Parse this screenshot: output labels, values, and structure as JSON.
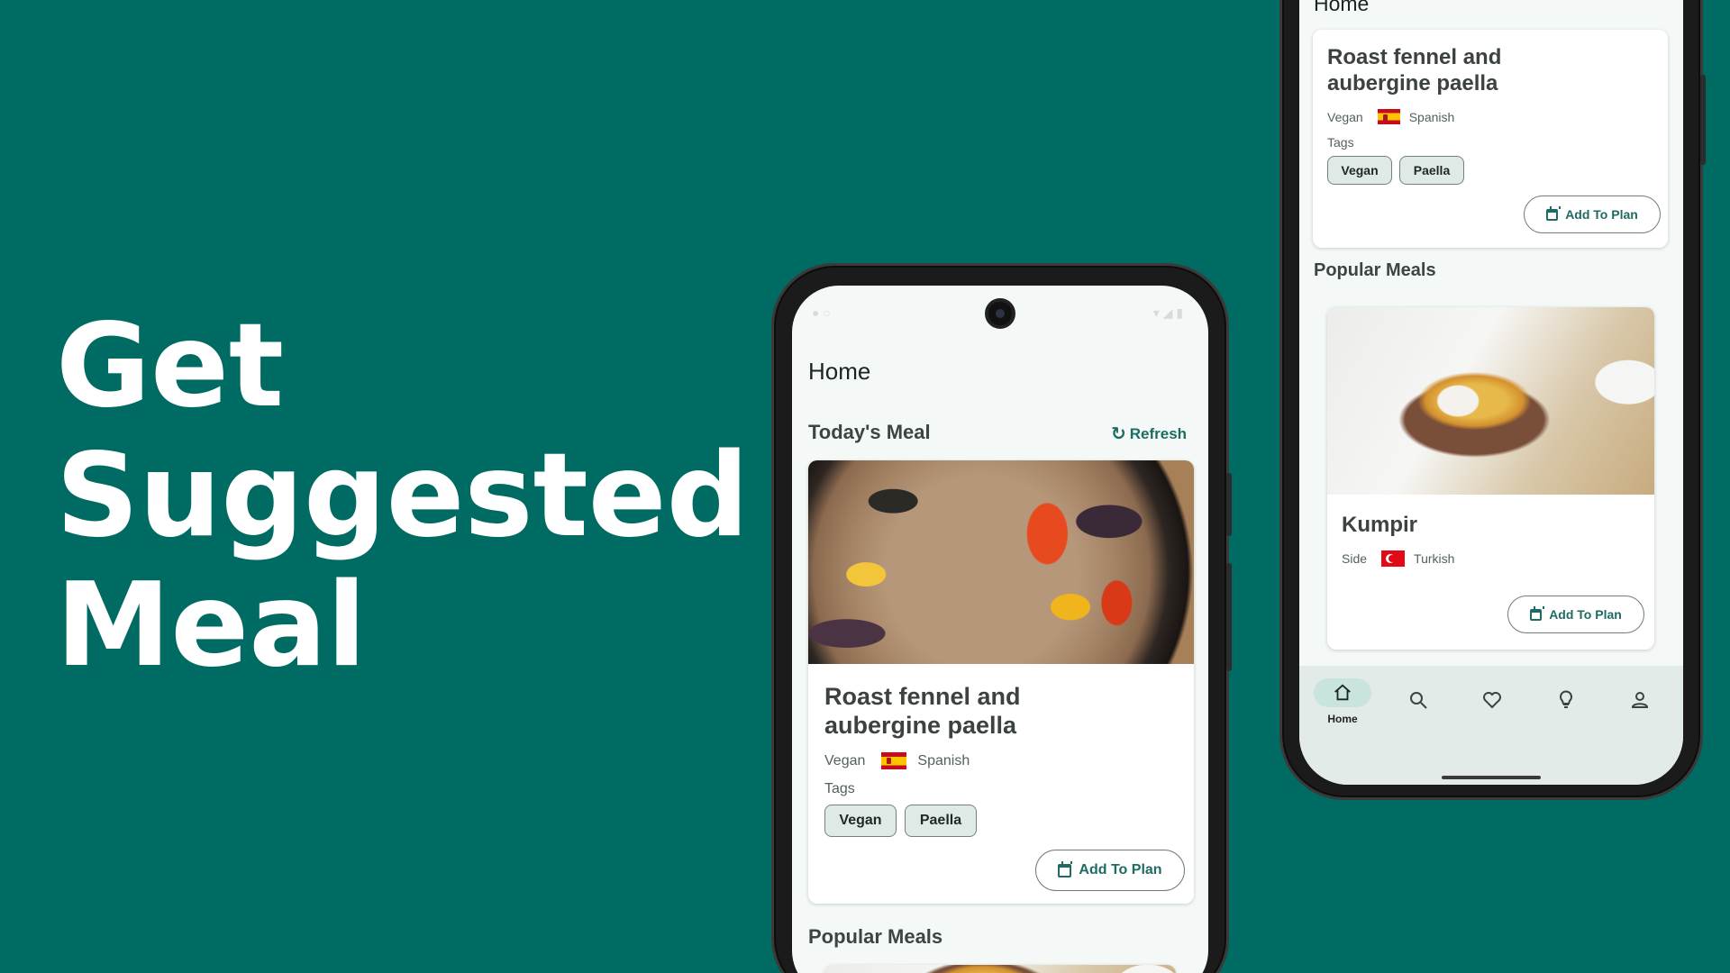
{
  "headline": {
    "line1": "Get",
    "line2": "Suggested",
    "line3": "Meal"
  },
  "colors": {
    "background": "#006b62",
    "accent": "#1e6b63",
    "chip_bg": "#dfe9e6",
    "screen_bg": "#f4f9f7"
  },
  "phone_main": {
    "app_bar_title": "Home",
    "todays_meal_title": "Today's Meal",
    "refresh_label": "Refresh",
    "meal": {
      "name_line1": "Roast fennel and",
      "name_line2": "aubergine paella",
      "category": "Vegan",
      "area": "Spanish",
      "tags_label": "Tags",
      "tags": [
        "Vegan",
        "Paella"
      ],
      "add_to_plan_label": "Add To Plan"
    },
    "popular_title": "Popular Meals"
  },
  "phone_secondary": {
    "app_bar_title": "Home",
    "meal": {
      "name_line1": "Roast fennel and",
      "name_line2": "aubergine paella",
      "category": "Vegan",
      "area": "Spanish",
      "tags_label": "Tags",
      "tags": [
        "Vegan",
        "Paella"
      ],
      "add_to_plan_label": "Add To Plan"
    },
    "popular_title": "Popular Meals",
    "popular_meal": {
      "name": "Kumpir",
      "category": "Side",
      "area": "Turkish",
      "add_to_plan_label": "Add To Plan"
    },
    "bottom_nav": {
      "home_label": "Home",
      "icons": [
        "home-icon",
        "search-icon",
        "heart-icon",
        "lightbulb-icon",
        "person-icon"
      ]
    }
  }
}
